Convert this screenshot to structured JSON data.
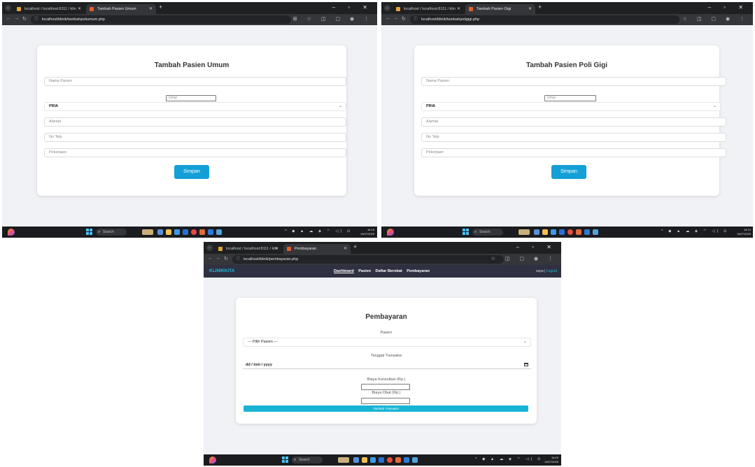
{
  "screens": [
    {
      "tabs": [
        {
          "title": "localhost / localhost:8111 / klin"
        },
        {
          "title": "Tambah Pasien Umum"
        }
      ],
      "url": "localhost/klinik/tambahpoliumum.php",
      "form": {
        "title": "Tambah Pasien Umum",
        "nama_placeholder": "Nama Pasien",
        "umur_placeholder": "Umur",
        "gender_value": "PRIA",
        "alamat_placeholder": "Alamat",
        "telp_placeholder": "No Telp",
        "pekerjaan_placeholder": "Pekerjaan",
        "submit_label": "Simpan"
      },
      "taskbar": {
        "search": "Search",
        "time": "16:16",
        "date": "19/07/2025"
      }
    },
    {
      "tabs": [
        {
          "title": "localhost / localhost:8111 / klin"
        },
        {
          "title": "Tambah Pasien Gigi"
        }
      ],
      "url": "localhost/klinik/tambahpoligigi.php",
      "form": {
        "title": "Tambah Pasien Poli Gigi",
        "nama_placeholder": "Nama Pasien",
        "umur_placeholder": "Umur",
        "gender_value": "PRIA",
        "alamat_placeholder": "Alamat",
        "telp_placeholder": "No Telp",
        "pekerjaan_placeholder": "Pekerjaan",
        "submit_label": "Simpan"
      },
      "taskbar": {
        "search": "Search",
        "time": "16:19",
        "date": "19/07/2025"
      }
    },
    {
      "tabs": [
        {
          "title": "localhost / localhost:8111 / klin"
        },
        {
          "title": "Pembayaran"
        }
      ],
      "url": "localhost/klinik/pembayaran.php",
      "navbar": {
        "brand": "KLINIKKITA",
        "links": [
          "Dashboard",
          "Pasien",
          "Daftar Berobat",
          "Pembayaran"
        ],
        "user": "saya",
        "logout": "Logout"
      },
      "form": {
        "title": "Pembayaran",
        "pasien_label": "Pasien",
        "pasien_value": "--- Pilih Pasien ---",
        "tanggal_label": "Tanggal Transaksi",
        "tanggal_value": "dd / mm / yyyy",
        "konsultasi_label": "Biaya Konsultasi (Rp.)",
        "obat_label": "Biaya Obat (Rp.)",
        "submit_label": "Tambah Transaksi"
      },
      "taskbar": {
        "search": "Search",
        "time": "16:20",
        "date": "19/07/2025"
      }
    }
  ],
  "colors": {
    "accent": "#14a0d6",
    "navbar": "#2f3142",
    "brand": "#21b8d6"
  }
}
